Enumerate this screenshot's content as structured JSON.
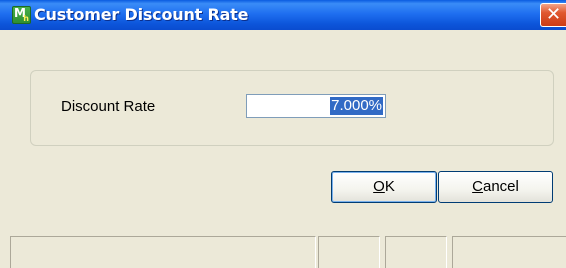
{
  "window": {
    "title": "Customer Discount Rate",
    "icon": "app-icon",
    "close_glyph": "✕"
  },
  "form": {
    "discount_label": "Discount Rate",
    "discount_value": "7.000%"
  },
  "buttons": {
    "ok_mnemonic": "O",
    "ok_rest": "K",
    "cancel_mnemonic": "C",
    "cancel_rest": "ancel"
  },
  "colors": {
    "titlebar": "#0a4ccf",
    "close": "#e0572f",
    "selection": "#316ac5",
    "dialog_bg": "#ece9d8"
  }
}
